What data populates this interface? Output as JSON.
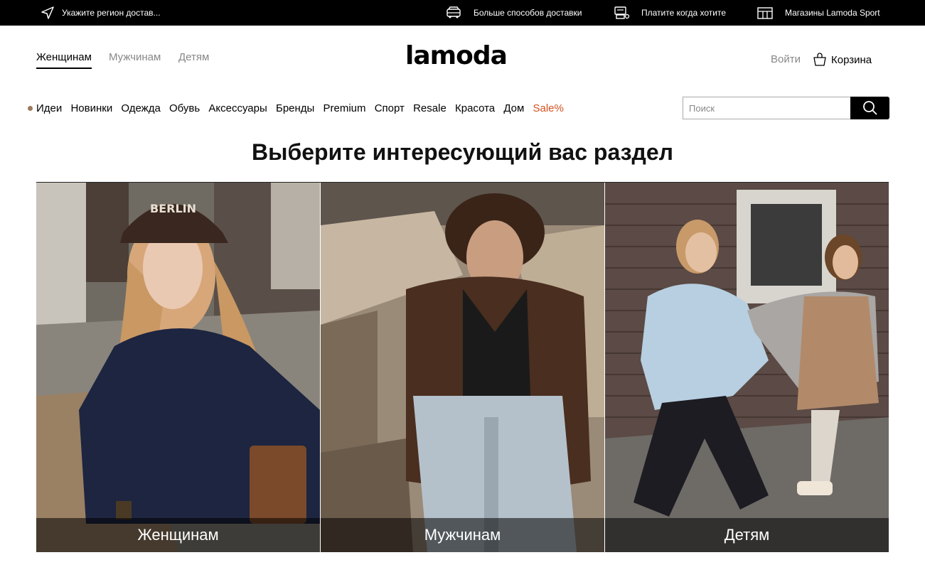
{
  "topbar": {
    "region": "Укажите регион достав...",
    "delivery": "Больше способов доставки",
    "pay_later": "Платите когда хотите",
    "stores": "Магазины Lamoda Sport"
  },
  "header": {
    "gender_tabs": [
      {
        "label": "Женщинам",
        "active": true
      },
      {
        "label": "Мужчинам",
        "active": false
      },
      {
        "label": "Детям",
        "active": false
      }
    ],
    "logo_text": "lamoda",
    "login": "Войти",
    "cart": "Корзина"
  },
  "categories": [
    "Идеи",
    "Новинки",
    "Одежда",
    "Обувь",
    "Аксессуары",
    "Бренды",
    "Premium",
    "Спорт",
    "Resale",
    "Красота",
    "Дом",
    "Sale%"
  ],
  "search": {
    "placeholder": "Поиск"
  },
  "main": {
    "heading": "Выберите интересующий вас раздел",
    "tiles": [
      {
        "label": "Женщинам",
        "photo": "woman in navy sweatshirt and Berlin cap sitting in a convertible car"
      },
      {
        "label": "Мужчинам",
        "photo": "man in brown leather jacket and light jeans sitting on a convertible car"
      },
      {
        "label": "Детям",
        "photo": "two girls playing in front of a brick wall"
      }
    ]
  },
  "colors": {
    "sale": "#d4521f",
    "ideas_dot": "#9c7a5c",
    "topbar_bg": "#000000"
  }
}
